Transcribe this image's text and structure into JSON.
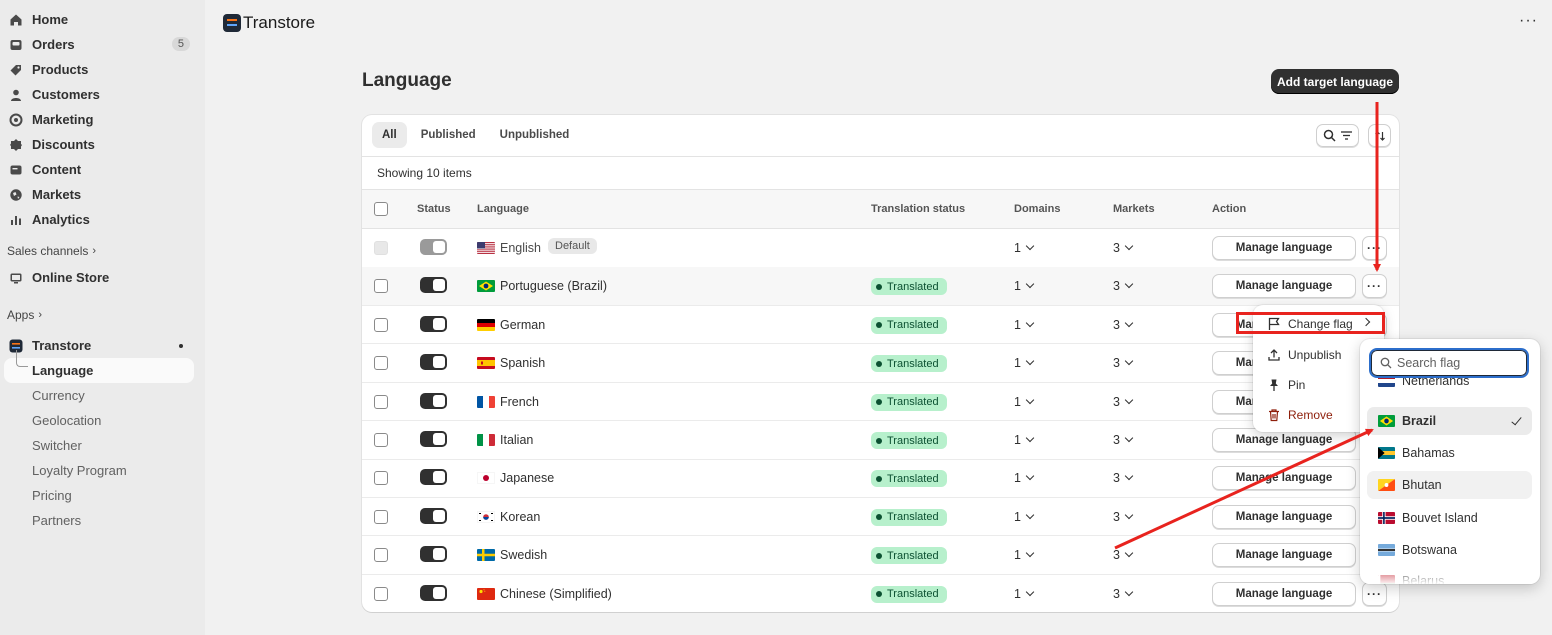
{
  "sidebar": {
    "nav": [
      {
        "label": "Home",
        "icon": "home-icon"
      },
      {
        "label": "Orders",
        "icon": "inbox-icon",
        "badge": "5"
      },
      {
        "label": "Products",
        "icon": "tag-icon"
      },
      {
        "label": "Customers",
        "icon": "person-icon"
      },
      {
        "label": "Marketing",
        "icon": "target-icon"
      },
      {
        "label": "Discounts",
        "icon": "discount-icon"
      },
      {
        "label": "Content",
        "icon": "content-icon"
      },
      {
        "label": "Markets",
        "icon": "globe-icon"
      },
      {
        "label": "Analytics",
        "icon": "chart-icon"
      }
    ],
    "sales_channels_label": "Sales channels",
    "online_store_label": "Online Store",
    "apps_label": "Apps",
    "app_name": "Transtore",
    "app_subitems": [
      "Language",
      "Currency",
      "Geolocation",
      "Switcher",
      "Loyalty Program",
      "Pricing",
      "Partners"
    ]
  },
  "topbar": {
    "title": "Transtore",
    "more": "···"
  },
  "page": {
    "title": "Language",
    "primary_action": "Add target language",
    "tabs": [
      "All",
      "Published",
      "Unpublished"
    ],
    "showing": "Showing 10 items",
    "columns": {
      "status": "Status",
      "language": "Language",
      "translation_status": "Translation status",
      "domains": "Domains",
      "markets": "Markets",
      "action": "Action"
    }
  },
  "rows": [
    {
      "language": "English",
      "flag": "us",
      "default_badge": "Default",
      "status": "",
      "domains": "1",
      "markets": "3",
      "action": "Manage language",
      "published": false
    },
    {
      "language": "Portuguese (Brazil)",
      "flag": "br",
      "status": "Translated",
      "domains": "1",
      "markets": "3",
      "action": "Manage language",
      "published": true
    },
    {
      "language": "German",
      "flag": "de",
      "status": "Translated",
      "domains": "1",
      "markets": "3",
      "action": "Manage language",
      "published": true
    },
    {
      "language": "Spanish",
      "flag": "es",
      "status": "Translated",
      "domains": "1",
      "markets": "3",
      "action": "Manage language",
      "published": true
    },
    {
      "language": "French",
      "flag": "fr",
      "status": "Translated",
      "domains": "1",
      "markets": "3",
      "action": "Manage language",
      "published": true
    },
    {
      "language": "Italian",
      "flag": "it",
      "status": "Translated",
      "domains": "1",
      "markets": "3",
      "action": "Manage language",
      "published": true
    },
    {
      "language": "Japanese",
      "flag": "jp",
      "status": "Translated",
      "domains": "1",
      "markets": "3",
      "action": "Manage language",
      "published": true
    },
    {
      "language": "Korean",
      "flag": "kr",
      "status": "Translated",
      "domains": "1",
      "markets": "3",
      "action": "Manage language",
      "published": true
    },
    {
      "language": "Swedish",
      "flag": "se",
      "status": "Translated",
      "domains": "1",
      "markets": "3",
      "action": "Manage language",
      "published": true
    },
    {
      "language": "Chinese (Simplified)",
      "flag": "cn",
      "status": "Translated",
      "domains": "1",
      "markets": "3",
      "action": "Manage language",
      "published": true
    }
  ],
  "menu": {
    "change_flag": "Change flag",
    "unpublish": "Unpublish",
    "pin": "Pin",
    "remove": "Remove"
  },
  "flag_picker": {
    "search_placeholder": "Search flag",
    "options": [
      {
        "name": "Netherlands",
        "flag": "nl"
      },
      {
        "name": "Brazil",
        "flag": "br",
        "selected": true
      },
      {
        "name": "Bahamas",
        "flag": "bs"
      },
      {
        "name": "Bhutan",
        "flag": "bt"
      },
      {
        "name": "Bouvet Island",
        "flag": "bv"
      },
      {
        "name": "Botswana",
        "flag": "bw"
      },
      {
        "name": "Belarus",
        "flag": "by"
      }
    ]
  },
  "colors": {
    "annotation_red": "#e8231e",
    "translated_bg": "#b7f0cc",
    "translated_text": "#0c5132",
    "primary_btn": "#303030"
  }
}
